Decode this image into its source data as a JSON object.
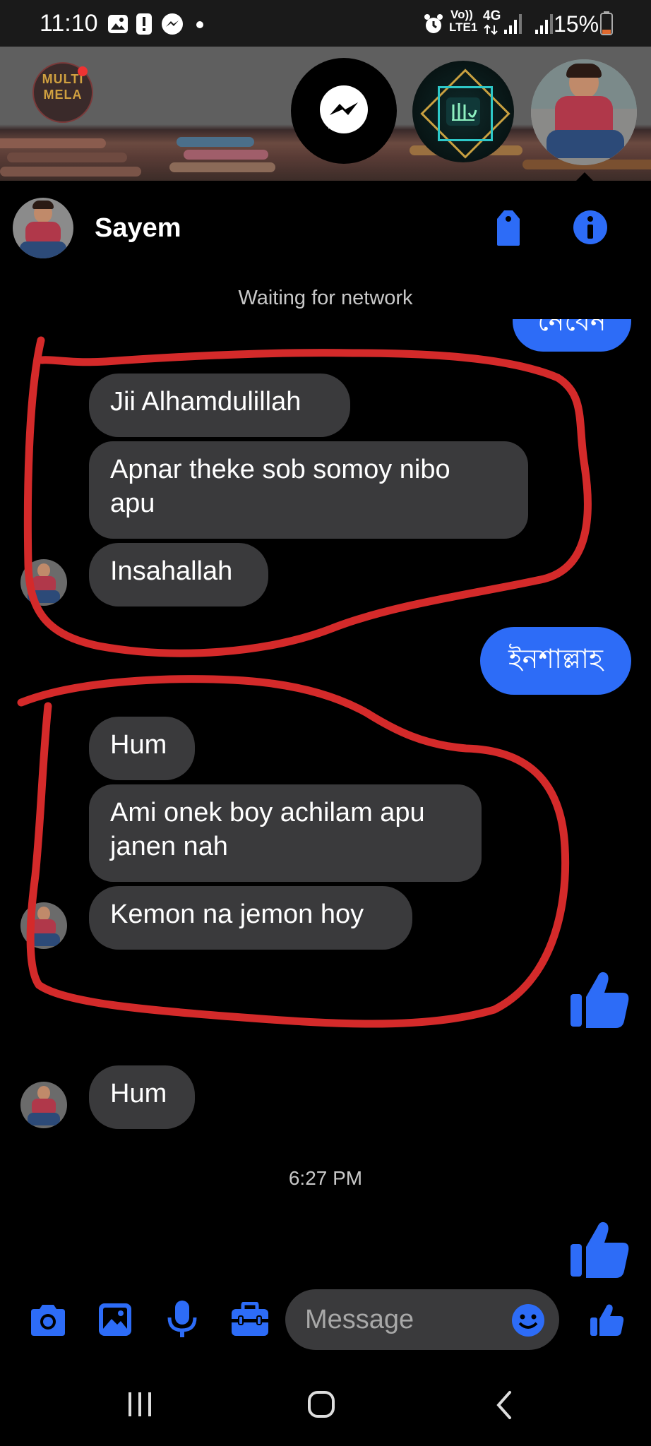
{
  "status_bar": {
    "time": "11:10",
    "network_line1": "Vo))",
    "network_line2": "LTE1",
    "network_type": "4G",
    "battery": "15%",
    "icons": [
      "photo-icon",
      "alert-icon",
      "messenger-icon",
      "alarm-icon",
      "signal-icon",
      "battery-icon"
    ]
  },
  "chat_heads": {
    "app_logo_line1": "MULTI",
    "app_logo_line2": "MELA",
    "icons": [
      "messenger-head-icon",
      "allah-calligraphy-avatar",
      "sayem-avatar-head"
    ]
  },
  "header": {
    "contact_name": "Sayem",
    "icons": [
      "tag-icon",
      "info-icon"
    ]
  },
  "network_status": "Waiting for network",
  "messages": {
    "partial_outgoing": "নেবেন",
    "m1": "Jii Alhamdulillah",
    "m2_line1": "Apnar theke sob somoy nibo",
    "m2_line2": "apu",
    "m3": "Insahallah",
    "m4_outgoing": "ইনশাল্লাহ",
    "m5": "Hum",
    "m6_line1": "Ami onek boy achilam apu",
    "m6_line2": "janen nah",
    "m7": "Kemon na jemon hoy",
    "m8": "Hum"
  },
  "timestamp": "6:27 PM",
  "composer": {
    "placeholder": "Message",
    "icons": [
      "camera-icon",
      "gallery-icon",
      "mic-icon",
      "toolbox-icon",
      "emoji-icon",
      "like-icon"
    ]
  },
  "colors": {
    "accent": "#2d6cf7",
    "incoming_bubble": "#3a3a3c",
    "annotation_red": "#d42a2a",
    "background": "#000000"
  }
}
